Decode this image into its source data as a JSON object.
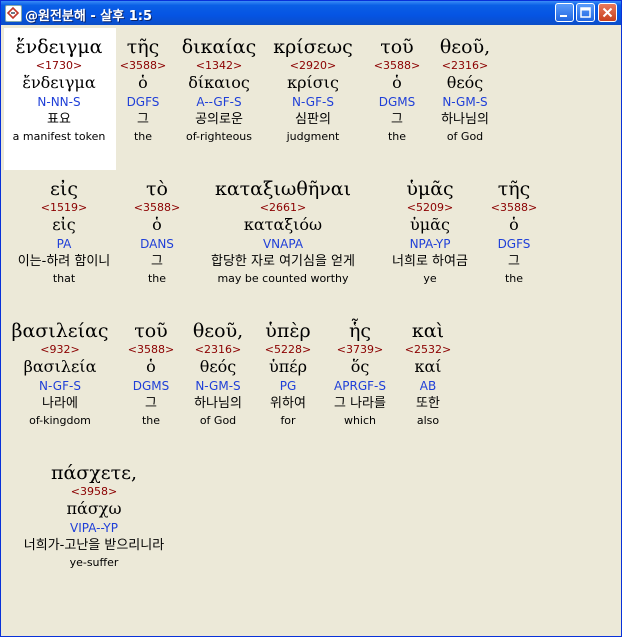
{
  "window": {
    "title": "@원전분해 - 살후 1:5"
  },
  "words": [
    {
      "greek": "ἔνδειγμα",
      "strong": "<1730>",
      "lemma": "ἔνδειγμα",
      "parse": "N-NN-S",
      "korean": "표요",
      "english": "a manifest token"
    },
    {
      "greek": "τῆς",
      "strong": "<3588>",
      "lemma": "ὁ",
      "parse": "DGFS",
      "korean": "그",
      "english": "the"
    },
    {
      "greek": "δικαίας",
      "strong": "<1342>",
      "lemma": "δίκαιος",
      "parse": "A--GF-S",
      "korean": "공의로운",
      "english": "of-righteous"
    },
    {
      "greek": "κρίσεως",
      "strong": "<2920>",
      "lemma": "κρίσις",
      "parse": "N-GF-S",
      "korean": "심판의",
      "english": "judgment"
    },
    {
      "greek": "τοῦ",
      "strong": "<3588>",
      "lemma": "ὁ",
      "parse": "DGMS",
      "korean": "그",
      "english": "the"
    },
    {
      "greek": "θεοῦ,",
      "strong": "<2316>",
      "lemma": "θεός",
      "parse": "N-GM-S",
      "korean": "하나님의",
      "english": "of God"
    },
    {
      "greek": "εἰς",
      "strong": "<1519>",
      "lemma": "εἰς",
      "parse": "PA",
      "korean": "이는-하려 함이니",
      "english": "that"
    },
    {
      "greek": "τὸ",
      "strong": "<3588>",
      "lemma": "ὁ",
      "parse": "DANS",
      "korean": "그",
      "english": "the"
    },
    {
      "greek": "καταξιωθῆναι",
      "strong": "<2661>",
      "lemma": "καταξιόω",
      "parse": "VNAPA",
      "korean": "합당한 자로 여기심을 얻게",
      "english": "may be counted worthy"
    },
    {
      "greek": "ὑμᾶς",
      "strong": "<5209>",
      "lemma": "ὑμᾶς",
      "parse": "NPA-YP",
      "korean": "너희로 하여금",
      "english": "ye"
    },
    {
      "greek": "τῆς",
      "strong": "<3588>",
      "lemma": "ὁ",
      "parse": "DGFS",
      "korean": "그",
      "english": "the"
    },
    {
      "greek": "βασιλείας",
      "strong": "<932>",
      "lemma": "βασιλεία",
      "parse": "N-GF-S",
      "korean": "나라에",
      "english": "of-kingdom"
    },
    {
      "greek": "τοῦ",
      "strong": "<3588>",
      "lemma": "ὁ",
      "parse": "DGMS",
      "korean": "그",
      "english": "the"
    },
    {
      "greek": "θεοῦ,",
      "strong": "<2316>",
      "lemma": "θεός",
      "parse": "N-GM-S",
      "korean": "하나님의",
      "english": "of God"
    },
    {
      "greek": "ὑπὲρ",
      "strong": "<5228>",
      "lemma": "ὑπέρ",
      "parse": "PG",
      "korean": "위하여",
      "english": "for"
    },
    {
      "greek": "ἧς",
      "strong": "<3739>",
      "lemma": "ὅς",
      "parse": "APRGF-S",
      "korean": "그 나라를",
      "english": "which"
    },
    {
      "greek": "καὶ",
      "strong": "<2532>",
      "lemma": "καί",
      "parse": "AB",
      "korean": "또한",
      "english": "also"
    },
    {
      "greek": "πάσχετε,",
      "strong": "<3958>",
      "lemma": "πάσχω",
      "parse": "VIPA--YP",
      "korean": "너희가-고난을 받으리니라",
      "english": "ye-suffer"
    }
  ]
}
